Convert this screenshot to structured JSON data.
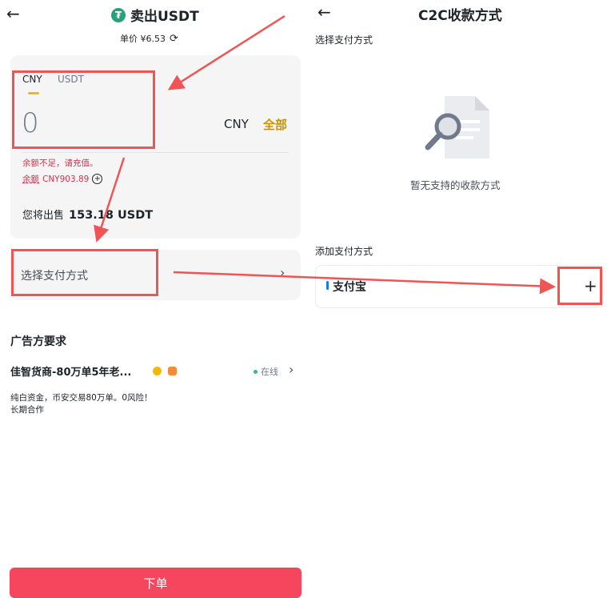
{
  "left": {
    "header": {
      "title": "卖出USDT",
      "back_icon": "arrow-left-icon"
    },
    "price": {
      "text": "单价 ¥6.53"
    },
    "tabs": [
      "CNY",
      "USDT"
    ],
    "amount": {
      "value": "0",
      "currency": "CNY",
      "all_label": "全部"
    },
    "warning": "余额不足，请充值。",
    "balance": {
      "label": "余额",
      "value": "CNY903.89"
    },
    "sell_summary": {
      "prefix": "您将出售",
      "amount": "153.18 USDT"
    },
    "payment": {
      "label": "选择支付方式",
      "chevron": "›"
    },
    "advertiser": {
      "section_title": "广告方要求",
      "name": "佳智货商-80万单5年老...",
      "status": "在线",
      "remark_line1": "纯白资金，币安交易80万单。0风险！",
      "remark_line2": "长期合作"
    },
    "order_button": "下单"
  },
  "right": {
    "header": {
      "title": "C2C收款方式",
      "back_icon": "arrow-left-icon"
    },
    "select_section": "选择支付方式",
    "empty_text": "暂无支持的收款方式",
    "add_section": "添加支付方式",
    "method": {
      "label": "支付宝",
      "add_icon": "+"
    }
  },
  "colors": {
    "accent": "#f0b90b",
    "danger": "#f6465d",
    "annotation": "#f05454",
    "tether": "#26a17b"
  }
}
